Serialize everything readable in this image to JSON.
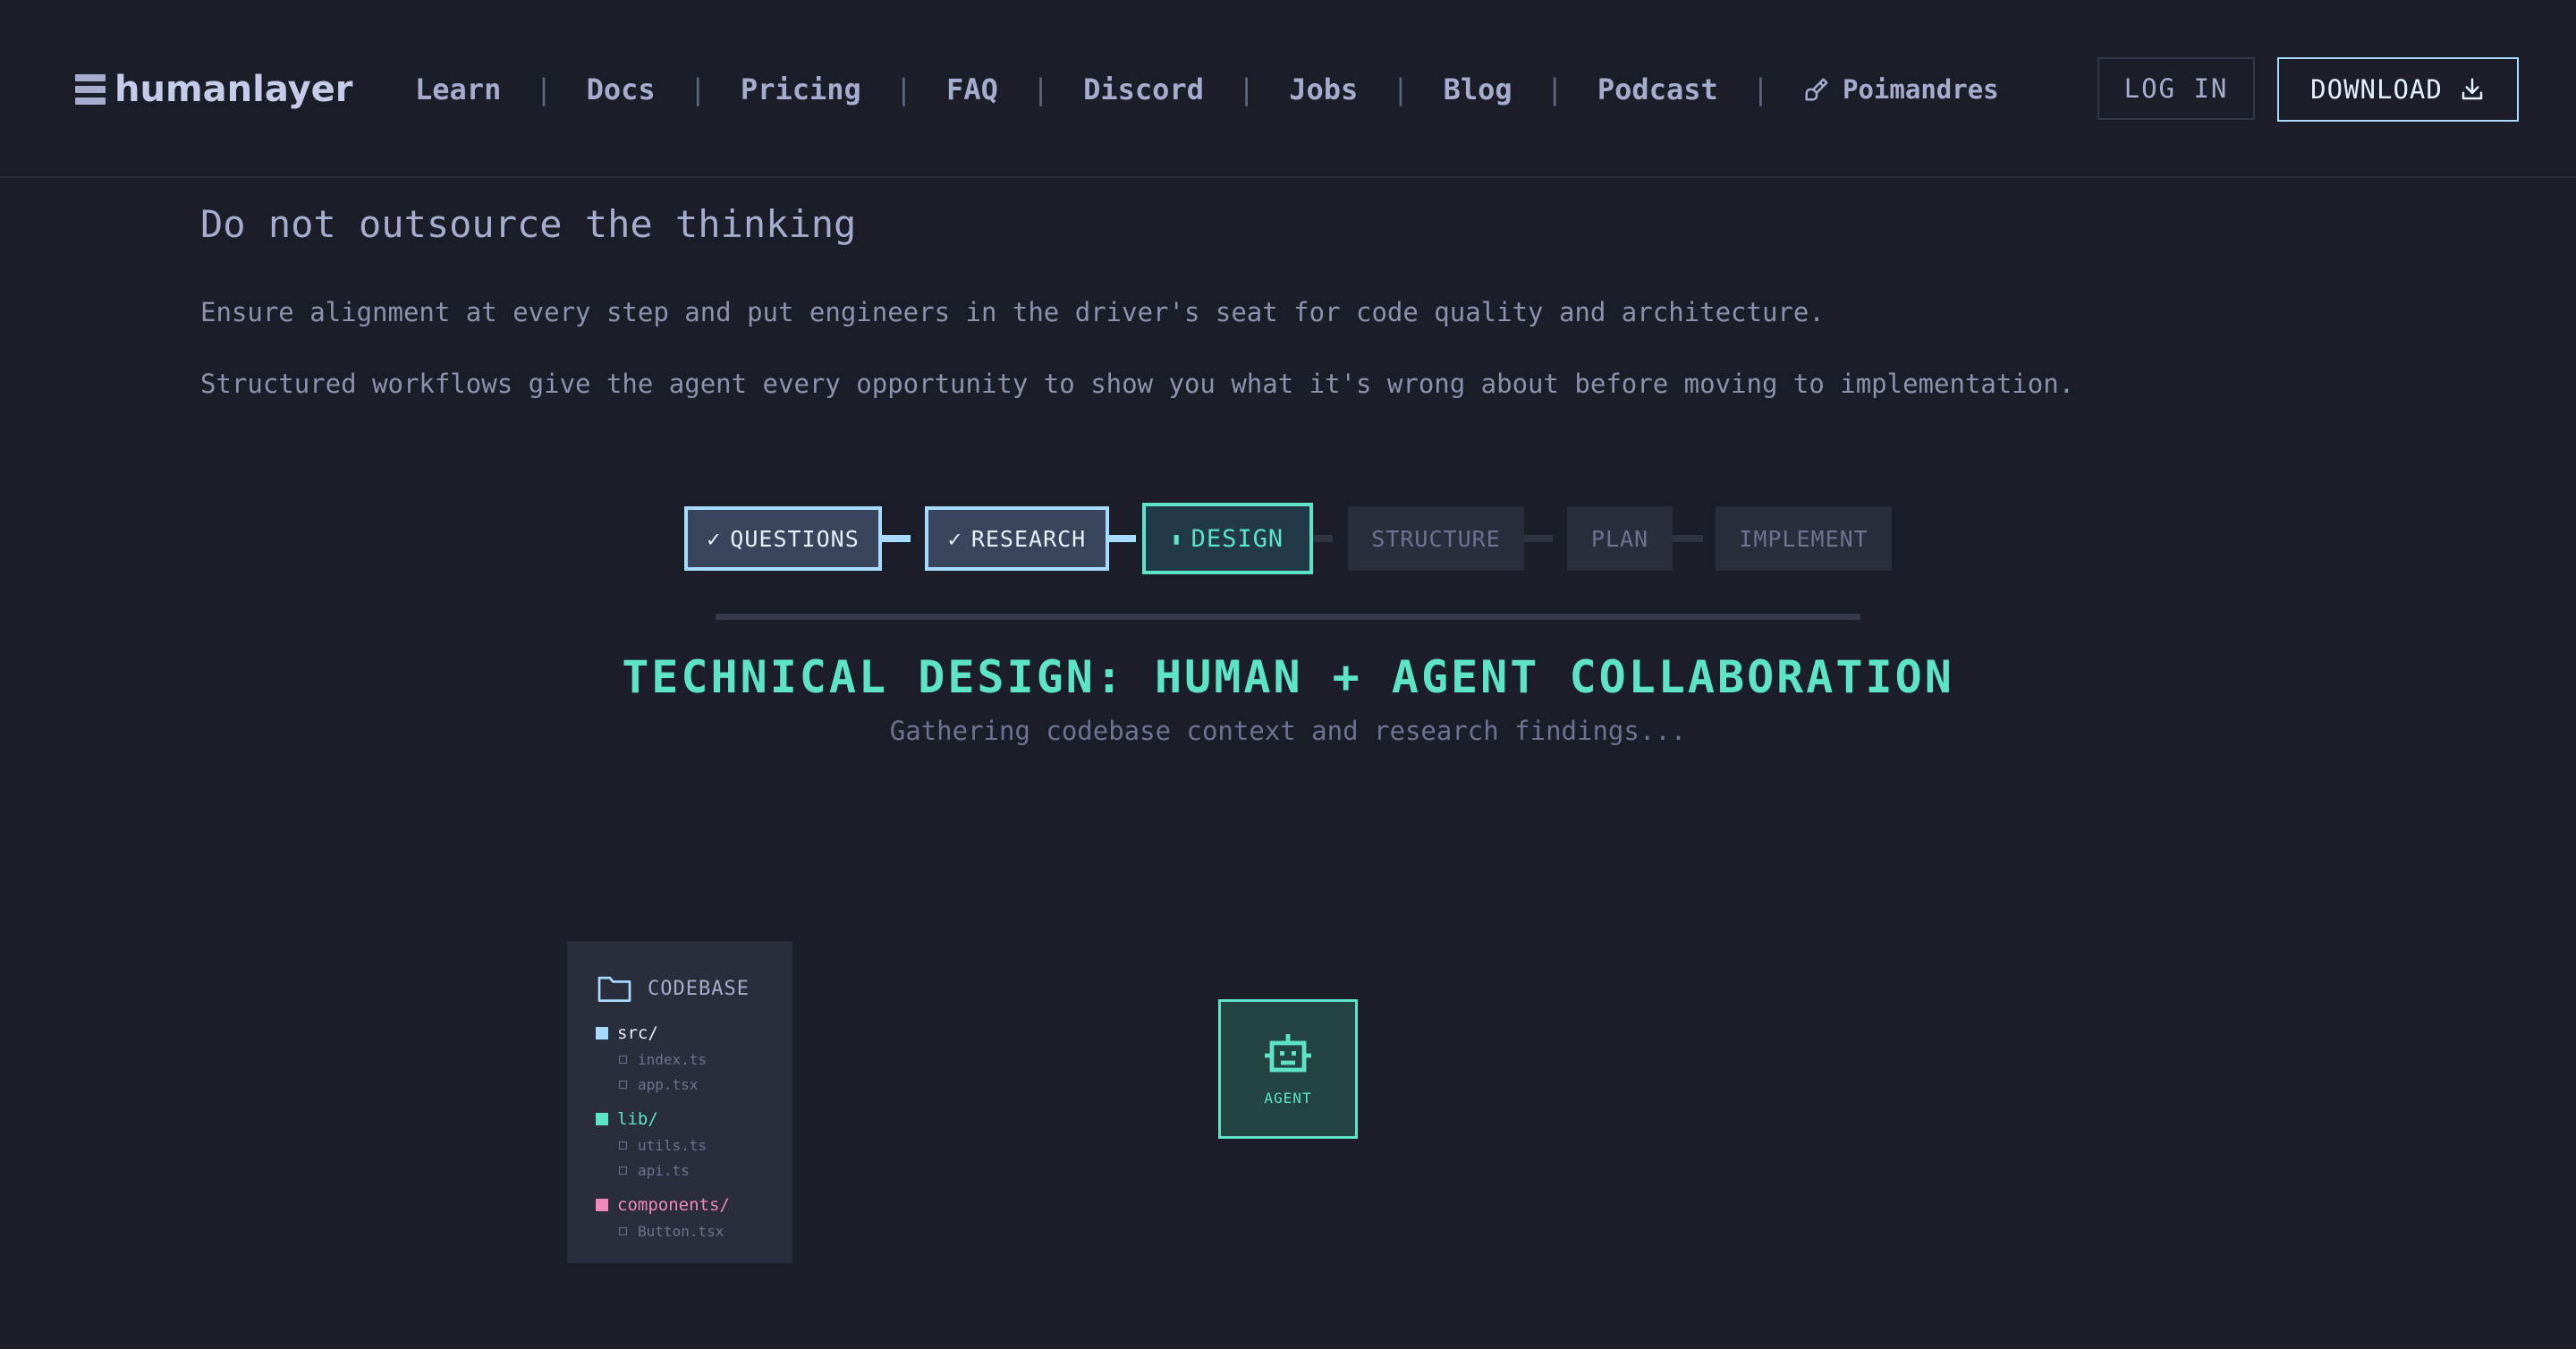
{
  "header": {
    "brand": "humanlayer",
    "nav": [
      "Learn",
      "Docs",
      "Pricing",
      "FAQ",
      "Discord",
      "Jobs",
      "Blog",
      "Podcast"
    ],
    "separator": "|",
    "theme_label": "Poimandres",
    "login_label": "LOG IN",
    "download_label": "DOWNLOAD"
  },
  "content": {
    "heading": "Do not outsource the thinking",
    "paragraph_1": "Ensure alignment at every step and put engineers in the driver's seat for code quality and architecture.",
    "paragraph_2": "Structured workflows give the agent every opportunity to show you what it's wrong about before moving to implementation."
  },
  "workflow": {
    "steps": [
      {
        "label": "QUESTIONS",
        "status": "done",
        "mark": "✓"
      },
      {
        "label": "RESEARCH",
        "status": "done",
        "mark": "✓"
      },
      {
        "label": "DESIGN",
        "status": "active",
        "mark": "▮"
      },
      {
        "label": "STRUCTURE",
        "status": "pending"
      },
      {
        "label": "PLAN",
        "status": "pending"
      },
      {
        "label": "IMPLEMENT",
        "status": "pending"
      }
    ],
    "title": "TECHNICAL DESIGN: HUMAN + AGENT COLLABORATION",
    "subtitle": "Gathering codebase context and research findings..."
  },
  "codebase": {
    "title": "CODEBASE",
    "folders": [
      {
        "name": "src/",
        "color": "#a6daff",
        "files": [
          "index.ts",
          "app.tsx"
        ]
      },
      {
        "name": "lib/",
        "color": "#5de4c7",
        "files": [
          "utils.ts",
          "api.ts"
        ]
      },
      {
        "name": "components/",
        "color": "#f087bd",
        "files": [
          "Button.tsx"
        ]
      }
    ]
  },
  "agent": {
    "label": "AGENT"
  },
  "colors": {
    "background": "#1b1e28",
    "accent": "#5de4c7",
    "done_blue": "#a6daff",
    "text": "#a6accd"
  }
}
